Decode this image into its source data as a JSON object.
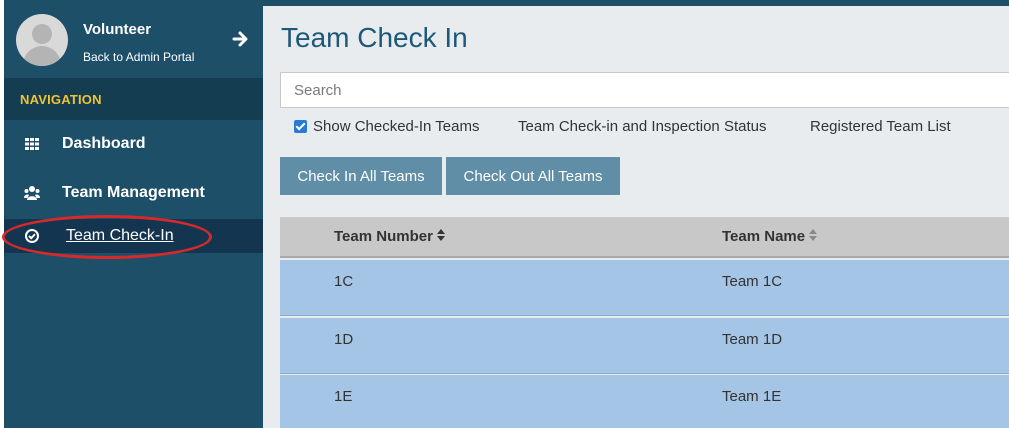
{
  "user": {
    "name": "Volunteer",
    "subtitle": "Back to Admin Portal"
  },
  "navigation": {
    "header": "NAVIGATION",
    "items": [
      {
        "label": "Dashboard",
        "icon": "grid-icon"
      },
      {
        "label": "Team Management",
        "icon": "users-icon"
      },
      {
        "label": "Team Check-In",
        "icon": "check-circle-icon",
        "active": true
      }
    ]
  },
  "main": {
    "title": "Team Check In",
    "search_placeholder": "Search",
    "show_checked_in_label": "Show Checked-In Teams",
    "show_checked_in_checked": true,
    "links": [
      "Team Check-in and Inspection Status",
      "Registered Team List"
    ],
    "buttons": {
      "check_in_all": "Check In All Teams",
      "check_out_all": "Check Out All Teams"
    },
    "table": {
      "columns": [
        "Team Number",
        "Team Name"
      ],
      "rows": [
        [
          "1C",
          "Team 1C"
        ],
        [
          "1D",
          "Team 1D"
        ],
        [
          "1E",
          "Team 1E"
        ]
      ]
    }
  },
  "colors": {
    "sidebar": "#1d4f69",
    "nav_header_text": "#f1c232",
    "highlight": "#d62a2a",
    "row_bg": "#a4c5e6",
    "button_bg": "#5f8ea6"
  }
}
